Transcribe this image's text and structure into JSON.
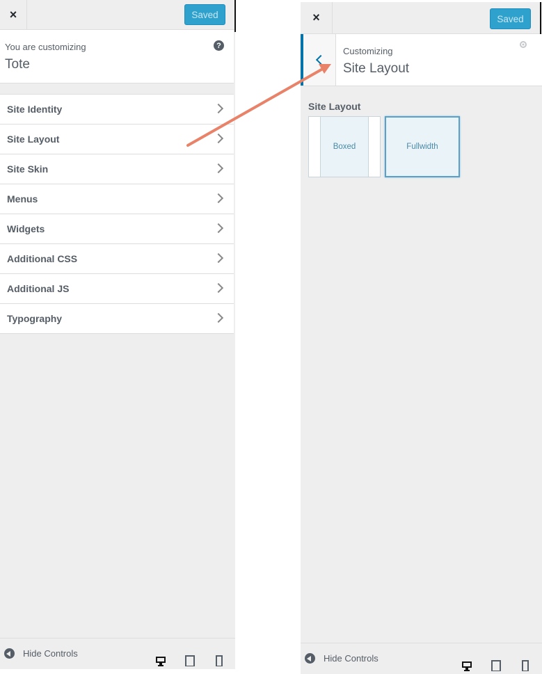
{
  "left": {
    "close_symbol": "×",
    "saved_label": "Saved",
    "info_small": "You are customizing",
    "info_big": "Tote",
    "help_symbol": "?",
    "sections": [
      {
        "label": "Site Identity"
      },
      {
        "label": "Site Layout"
      },
      {
        "label": "Site Skin"
      },
      {
        "label": "Menus"
      },
      {
        "label": "Widgets"
      },
      {
        "label": "Additional CSS"
      },
      {
        "label": "Additional JS"
      },
      {
        "label": "Typography"
      }
    ],
    "hide_controls": "Hide Controls"
  },
  "right": {
    "close_symbol": "×",
    "saved_label": "Saved",
    "header_small": "Customizing",
    "header_big": "Site Layout",
    "control_title": "Site Layout",
    "options": [
      {
        "label": "Boxed",
        "selected": false
      },
      {
        "label": "Fullwidth",
        "selected": true
      }
    ],
    "hide_controls": "Hide Controls"
  },
  "icons": {
    "close": "close-icon",
    "help": "help-icon",
    "chevron": "chevron-right-icon",
    "back": "chevron-left-icon",
    "gear": "gear-icon",
    "hide": "collapse-icon",
    "devices": [
      "desktop-icon",
      "tablet-icon",
      "mobile-icon"
    ]
  },
  "colors": {
    "accent": "#0073aa",
    "saved_button": "#2ea2cc",
    "annotation_arrow": "#e8836a"
  }
}
